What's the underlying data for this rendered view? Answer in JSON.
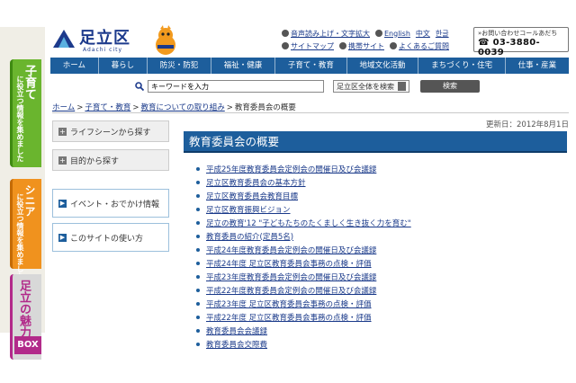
{
  "side_tabs": [
    {
      "main": "子育て",
      "sub": "に役立つ情報を集めました"
    },
    {
      "main": "シニア",
      "sub": "に役立つ情報を集めました"
    },
    {
      "main": "足立の魅力",
      "badge": "BOX"
    }
  ],
  "header": {
    "logo_text": "足立区",
    "logo_sub": "Adachi city",
    "links_row1": [
      "音声読み上げ・文字拡大",
      "English",
      "中文",
      "한글"
    ],
    "links_row2": [
      "サイトマップ",
      "携帯サイト",
      "よくあるご質問"
    ],
    "callcenter_label": "»お問い合わせコールあだち",
    "callcenter_number": "03-3880-0039"
  },
  "nav": [
    "ホーム",
    "暮らし",
    "防災・防犯",
    "福祉・健康",
    "子育て・教育",
    "地域文化活動",
    "まちづくり・住宅",
    "仕事・産業"
  ],
  "search": {
    "placeholder": "キーワードを入力",
    "scope": "足立区全体を検索",
    "button": "検索"
  },
  "breadcrumb": [
    "ホーム",
    "子育て・教育",
    "教育についての取り組み",
    "教育委員会の概要"
  ],
  "left_menu": [
    "ライフシーンから探す",
    "目的から探す"
  ],
  "left_menu2": [
    "イベント・おでかけ情報",
    "このサイトの使い方"
  ],
  "updated": "更新日：2012年8月1日",
  "page_title": "教育委員会の概要",
  "links": [
    "平成25年度教育委員会定例会の開催日及び会議録",
    "足立区教育委員会の基本方針",
    "足立区教育委員会教育目標",
    "足立区教育振興ビジョン",
    "足立の教育'12 \"子どもたちのたくましく生き抜く力を育む\"",
    "教育委員の紹介(定員5名)",
    "平成24年度教育委員会定例会の開催日及び会議録",
    "平成24年度 足立区教育委員会事務の点検・評価",
    "平成23年度教育委員会定例会の開催日及び会議録",
    "平成22年度教育委員会定例会の開催日及び会議録",
    "平成23年度 足立区教育委員会事務の点検・評価",
    "平成22年度 足立区教育委員会事務の点検・評価",
    "教育委員会会議録",
    "教育委員会交際費"
  ]
}
